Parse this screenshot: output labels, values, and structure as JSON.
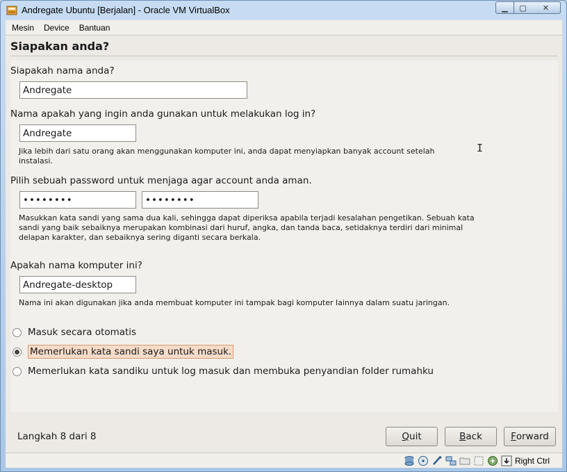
{
  "window": {
    "title": "Andregate Ubuntu [Berjalan] - Oracle VM VirtualBox",
    "minimize": "▁",
    "maximize": "▢",
    "close": "✕"
  },
  "menubar": {
    "items": [
      "Mesin",
      "Device",
      "Bantuan"
    ]
  },
  "installer": {
    "heading": "Siapakan anda?",
    "name_question": "Siapakah nama anda?",
    "name_value": "Andregate",
    "login_question": "Nama apakah yang ingin anda gunakan untuk melakukan log in?",
    "login_value": "Andregate",
    "login_note": "Jika lebih dari satu orang akan menggunakan komputer ini, anda dapat menyiapkan banyak account setelah instalasi.",
    "password_question": "Pilih sebuah password untuk menjaga agar account anda aman.",
    "password_value": "••••••••",
    "password_confirm_value": "••••••••",
    "password_note": "Masukkan kata sandi yang sama dua kali, sehingga dapat diperiksa apabila terjadi kesalahan pengetikan. Sebuah kata sandi yang baik sebaiknya merupakan kombinasi dari huruf, angka, dan tanda baca, setidaknya terdiri dari minimal delapan karakter, dan sebaiknya sering diganti secara berkala.",
    "computer_question": "Apakah nama komputer ini?",
    "computer_value": "Andregate-desktop",
    "computer_note": "Nama ini akan digunakan jika anda membuat komputer ini tampak bagi komputer lainnya dalam suatu jaringan.",
    "login_options": [
      {
        "label": "Masuk secara otomatis",
        "selected": false
      },
      {
        "label": "Memerlukan kata sandi saya untuk masuk.",
        "selected": true
      },
      {
        "label": "Memerlukan kata sandiku untuk log masuk dan membuka penyandian folder rumahku",
        "selected": false
      }
    ],
    "step_text": "Langkah 8 dari 8",
    "buttons": {
      "quit_mnemonic": "Q",
      "quit_rest": "uit",
      "back_mnemonic": "B",
      "back_rest": "ack",
      "forward_mnemonic": "F",
      "forward_rest": "orward"
    }
  },
  "statusbar": {
    "host_key": "Right Ctrl",
    "icons": [
      "hard-disk-icon",
      "cd-icon",
      "usb-icon",
      "network-icon",
      "shared-folder-icon",
      "capture-icon",
      "mouse-integration-icon",
      "keyboard-capture-icon"
    ]
  }
}
